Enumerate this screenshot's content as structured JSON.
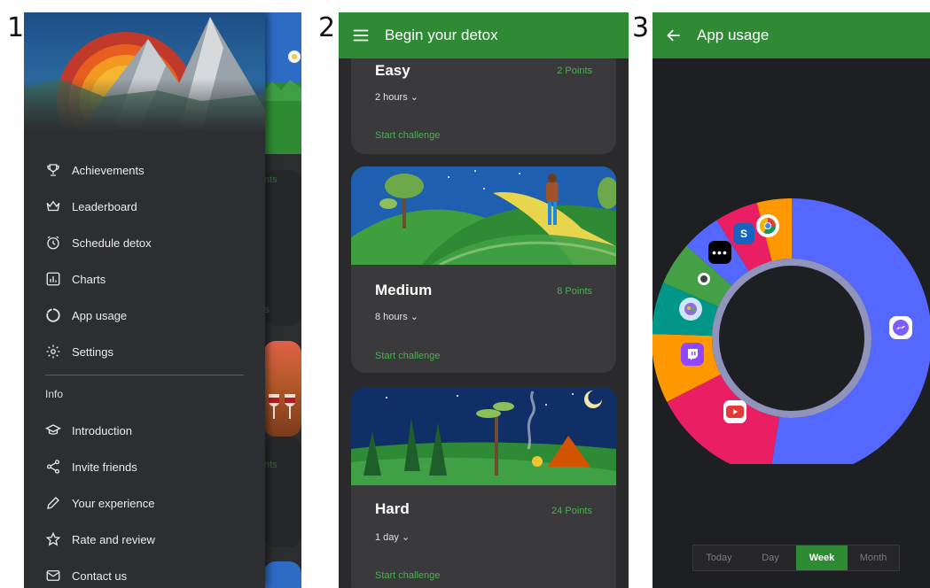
{
  "panels": [
    "1",
    "2",
    "3"
  ],
  "drawer": {
    "items": [
      {
        "label": "Achievements",
        "icon": "trophy-icon"
      },
      {
        "label": "Leaderboard",
        "icon": "crown-icon"
      },
      {
        "label": "Schedule detox",
        "icon": "alarm-icon"
      },
      {
        "label": "Charts",
        "icon": "chart-icon"
      },
      {
        "label": "App usage",
        "icon": "donut-icon"
      },
      {
        "label": "Settings",
        "icon": "gear-icon"
      }
    ],
    "section_title": "Info",
    "info_items": [
      {
        "label": "Introduction",
        "icon": "graduation-cap-icon"
      },
      {
        "label": "Invite friends",
        "icon": "share-icon"
      },
      {
        "label": "Your experience",
        "icon": "pencil-icon"
      },
      {
        "label": "Rate and review",
        "icon": "star-icon"
      },
      {
        "label": "Contact us",
        "icon": "mail-icon"
      }
    ],
    "peek_texts": [
      "nts",
      "s",
      "nts"
    ]
  },
  "detox": {
    "title": "Begin your detox",
    "challenges": [
      {
        "level": "Easy",
        "points": "2 Points",
        "duration": "2 hours",
        "action": "Start challenge"
      },
      {
        "level": "Medium",
        "points": "8 Points",
        "duration": "8 hours",
        "action": "Start challenge"
      },
      {
        "level": "Hard",
        "points": "24 Points",
        "duration": "1 day",
        "action": "Start challenge"
      }
    ]
  },
  "usage": {
    "title": "App usage",
    "tabs": [
      "Today",
      "Day",
      "Week",
      "Month"
    ],
    "active_tab": "Week",
    "chart_data": {
      "type": "pie",
      "segments": [
        {
          "app": "Messenger",
          "value": 52.5,
          "color": "#5468ff"
        },
        {
          "app": "YouTube",
          "value": 15.0,
          "color": "#e91e63"
        },
        {
          "app": "Twitch",
          "value": 8.0,
          "color": "#ff9800"
        },
        {
          "app": "Brain app",
          "value": 6.0,
          "color": "#009688"
        },
        {
          "app": "Settings",
          "value": 5.0,
          "color": "#43a047"
        },
        {
          "app": "Dots app",
          "value": 4.5,
          "color": "#5468ff"
        },
        {
          "app": "Shopping app",
          "value": 5.0,
          "color": "#e91e63"
        },
        {
          "app": "Chrome",
          "value": 4.0,
          "color": "#ff9800"
        }
      ]
    }
  },
  "colors": {
    "accent": "#2e8b34",
    "points": "#4caf50",
    "surface": "#3a3a3c"
  }
}
